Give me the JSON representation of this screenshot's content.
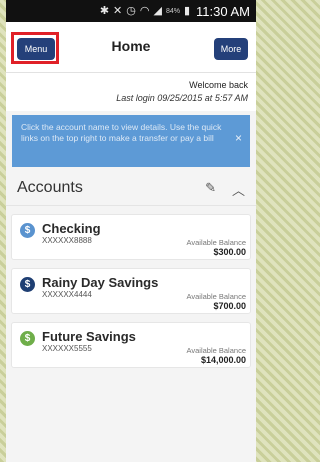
{
  "status_bar": {
    "icons": [
      "bluetooth-icon",
      "mute-icon",
      "alarm-icon",
      "wifi-icon",
      "signal-icon",
      "battery-icon"
    ],
    "battery": "84%",
    "time": "11:30 AM"
  },
  "header": {
    "menu_label": "Menu",
    "title": "Home",
    "more_label": "More",
    "highlight_color": "#e02027",
    "button_color": "#24407a"
  },
  "welcome": {
    "greeting": "Welcome back",
    "last_login": "Last login 09/25/2015 at 5:57 AM"
  },
  "notice": {
    "text": "Click the account name to view details. Use the quick links on the top right to make a transfer or pay a bill",
    "close": "×",
    "color": "#5d9ad6"
  },
  "accounts": {
    "title": "Accounts",
    "items": [
      {
        "name": "Checking",
        "number": "XXXXXX8888",
        "balance_label": "Available Balance",
        "balance": "$300.00",
        "icon_color": "#5a93cf"
      },
      {
        "name": "Rainy Day Savings",
        "number": "XXXXXX4444",
        "balance_label": "Available Balance",
        "balance": "$700.00",
        "icon_color": "#1f3f73"
      },
      {
        "name": "Future Savings",
        "number": "XXXXXX5555",
        "balance_label": "Available Balance",
        "balance": "$14,000.00",
        "icon_color": "#6fae4a"
      }
    ]
  }
}
